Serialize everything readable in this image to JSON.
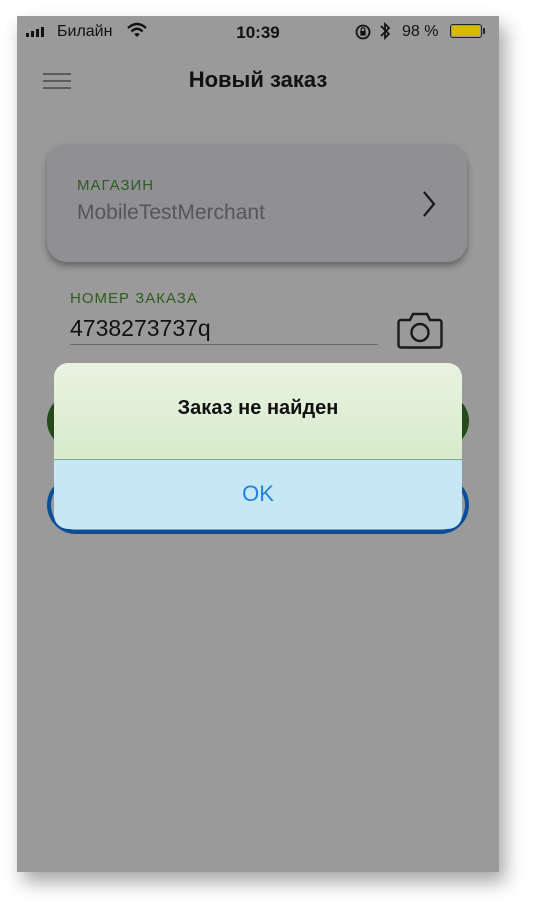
{
  "status_bar": {
    "carrier": "Билайн",
    "time": "10:39",
    "battery_percent": "98 %",
    "battery_level": 0.98,
    "battery_color": "#d9b800"
  },
  "nav": {
    "title": "Новый заказ",
    "menu_icon": "hamburger-menu-icon"
  },
  "store": {
    "label": "МАГАЗИН",
    "value": "MobileTestMerchant",
    "icon": "chevron-right-icon"
  },
  "order": {
    "label": "НОМЕР ЗАКАЗА",
    "value": "4738273737q",
    "icon": "camera-icon"
  },
  "alert": {
    "title": "Заказ не найден",
    "ok_label": "OK"
  },
  "colors": {
    "accent_green": "#2f5d1f",
    "button_green": "#24491a",
    "button_blue_border": "#0c4d99",
    "alert_ok_text": "#2480e0"
  }
}
